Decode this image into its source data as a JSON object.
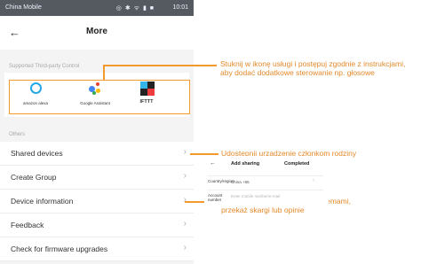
{
  "status_bar": {
    "carrier": "China Mobile",
    "icons": "◎ ✱ ᯤ ▮ ■",
    "time": "10:01"
  },
  "header": {
    "title": "More"
  },
  "third_party": {
    "section_label": "Supported Third-party Control",
    "items": [
      {
        "label": "amazon alexa",
        "icon": "alexa-icon"
      },
      {
        "label": "Google Assistant",
        "icon": "google-assistant-icon"
      },
      {
        "label": "IFTTT",
        "icon": "ifttt-icon"
      }
    ]
  },
  "others": {
    "section_label": "Others",
    "items": [
      {
        "label": "Shared devices"
      },
      {
        "label": "Create Group"
      },
      {
        "label": "Device information"
      },
      {
        "label": "Feedback"
      },
      {
        "label": "Check for firmware upgrades"
      }
    ]
  },
  "annotations": {
    "third_party": "Stuknij w ikonę usługi i postępuj zgodnie z instrukcjami, aby dodać dodatkowe sterowanie np. głosowe",
    "shared": "Udostępnij urządzenie członkom rodziny",
    "feedback": "Podziel się z nami swoimi problemami, przekaż skargi lub opinie"
  },
  "add_sharing": {
    "title": "Add sharing",
    "completed": "Completed",
    "country_label": "Country/region",
    "country_value": "China +86",
    "account_label": "Account number",
    "account_placeholder": "Enter mobile number/e-mail"
  },
  "colors": {
    "accent": "#f29a2e",
    "alexa": "#22a7e4"
  }
}
